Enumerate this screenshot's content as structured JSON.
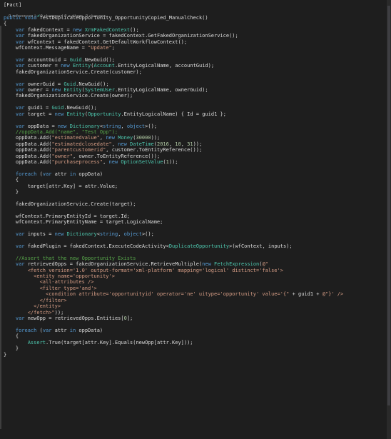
{
  "attribute": "[Fact]",
  "codelens": {
    "references": "0 references",
    "changes": "0 changes",
    "authors": "0 authors, 0 changes"
  },
  "code_lines": [
    [
      [
        "kw",
        "public"
      ],
      [
        "pl",
        " "
      ],
      [
        "kw",
        "void"
      ],
      [
        "pl",
        " TestDuplicateOpportunity_OpportunityCopied_ManualCheck()"
      ]
    ],
    [
      [
        "pl",
        "{"
      ]
    ],
    [
      [
        "pl",
        "    "
      ],
      [
        "kw",
        "var"
      ],
      [
        "pl",
        " fakedContext = "
      ],
      [
        "kw",
        "new"
      ],
      [
        "pl",
        " "
      ],
      [
        "ty",
        "XrmFakedContext"
      ],
      [
        "pl",
        "();"
      ]
    ],
    [
      [
        "pl",
        "    "
      ],
      [
        "kw",
        "var"
      ],
      [
        "pl",
        " fakedOrganizationService = fakedContext.GetFakedOrganizationService();"
      ]
    ],
    [
      [
        "pl",
        "    "
      ],
      [
        "kw",
        "var"
      ],
      [
        "pl",
        " wfContext = fakedContext.GetDefaultWorkflowContext();"
      ]
    ],
    [
      [
        "pl",
        "    wfContext.MessageName = "
      ],
      [
        "st",
        "\"Update\""
      ],
      [
        "pl",
        ";"
      ]
    ],
    [],
    [
      [
        "pl",
        "    "
      ],
      [
        "kw",
        "var"
      ],
      [
        "pl",
        " accountGuid = "
      ],
      [
        "ty",
        "Guid"
      ],
      [
        "pl",
        ".NewGuid();"
      ]
    ],
    [
      [
        "pl",
        "    "
      ],
      [
        "kw",
        "var"
      ],
      [
        "pl",
        " customer = "
      ],
      [
        "kw",
        "new"
      ],
      [
        "pl",
        " "
      ],
      [
        "ty",
        "Entity"
      ],
      [
        "pl",
        "("
      ],
      [
        "ty",
        "Account"
      ],
      [
        "pl",
        ".EntityLogicalName, accountGuid);"
      ]
    ],
    [
      [
        "pl",
        "    fakedOrganizationService.Create(customer);"
      ]
    ],
    [],
    [
      [
        "pl",
        "    "
      ],
      [
        "kw",
        "var"
      ],
      [
        "pl",
        " ownerGuid = "
      ],
      [
        "ty",
        "Guid"
      ],
      [
        "pl",
        ".NewGuid();"
      ]
    ],
    [
      [
        "pl",
        "    "
      ],
      [
        "kw",
        "var"
      ],
      [
        "pl",
        " owner = "
      ],
      [
        "kw",
        "new"
      ],
      [
        "pl",
        " "
      ],
      [
        "ty",
        "Entity"
      ],
      [
        "pl",
        "("
      ],
      [
        "ty",
        "SystemUser"
      ],
      [
        "pl",
        ".EntityLogicalName, ownerGuid);"
      ]
    ],
    [
      [
        "pl",
        "    fakedOrganizationService.Create(owner);"
      ]
    ],
    [],
    [
      [
        "pl",
        "    "
      ],
      [
        "kw",
        "var"
      ],
      [
        "pl",
        " guid1 = "
      ],
      [
        "ty",
        "Guid"
      ],
      [
        "pl",
        ".NewGuid();"
      ]
    ],
    [
      [
        "pl",
        "    "
      ],
      [
        "kw",
        "var"
      ],
      [
        "pl",
        " target = "
      ],
      [
        "kw",
        "new"
      ],
      [
        "pl",
        " "
      ],
      [
        "ty",
        "Entity"
      ],
      [
        "pl",
        "("
      ],
      [
        "ty",
        "Opportunity"
      ],
      [
        "pl",
        ".EntityLogicalName) { Id = guid1 };"
      ]
    ],
    [],
    [
      [
        "pl",
        "    "
      ],
      [
        "kw",
        "var"
      ],
      [
        "pl",
        " oppData = "
      ],
      [
        "kw",
        "new"
      ],
      [
        "pl",
        " "
      ],
      [
        "ty",
        "Dictionary"
      ],
      [
        "pl",
        "<"
      ],
      [
        "kw",
        "string"
      ],
      [
        "pl",
        ", "
      ],
      [
        "kw",
        "object"
      ],
      [
        "pl",
        ">();"
      ]
    ],
    [
      [
        "pl",
        "    "
      ],
      [
        "cm",
        "//oppData.Add(\"name\", \"Test Opp\");"
      ]
    ],
    [
      [
        "pl",
        "    oppData.Add("
      ],
      [
        "st",
        "\"estimatedvalue\""
      ],
      [
        "pl",
        ", "
      ],
      [
        "kw",
        "new"
      ],
      [
        "pl",
        " "
      ],
      [
        "ty",
        "Money"
      ],
      [
        "pl",
        "("
      ],
      [
        "nm",
        "30000"
      ],
      [
        "pl",
        "));"
      ]
    ],
    [
      [
        "pl",
        "    oppData.Add("
      ],
      [
        "st",
        "\"estimatedclosedate\""
      ],
      [
        "pl",
        ", "
      ],
      [
        "kw",
        "new"
      ],
      [
        "pl",
        " "
      ],
      [
        "ty",
        "DateTime"
      ],
      [
        "pl",
        "("
      ],
      [
        "nm",
        "2016"
      ],
      [
        "pl",
        ", "
      ],
      [
        "nm",
        "10"
      ],
      [
        "pl",
        ", "
      ],
      [
        "nm",
        "31"
      ],
      [
        "pl",
        "));"
      ]
    ],
    [
      [
        "pl",
        "    oppData.Add("
      ],
      [
        "st",
        "\"parentcustomerid\""
      ],
      [
        "pl",
        ", customer.ToEntityReference());"
      ]
    ],
    [
      [
        "pl",
        "    oppData.Add("
      ],
      [
        "st",
        "\"owner\""
      ],
      [
        "pl",
        ", owner.ToEntityReference());"
      ]
    ],
    [
      [
        "pl",
        "    oppData.Add("
      ],
      [
        "st",
        "\"purchaseprocess\""
      ],
      [
        "pl",
        ", "
      ],
      [
        "kw",
        "new"
      ],
      [
        "pl",
        " "
      ],
      [
        "ty",
        "OptionSetValue"
      ],
      [
        "pl",
        "("
      ],
      [
        "nm",
        "1"
      ],
      [
        "pl",
        "));"
      ]
    ],
    [],
    [
      [
        "pl",
        "    "
      ],
      [
        "kw",
        "foreach"
      ],
      [
        "pl",
        " ("
      ],
      [
        "kw",
        "var"
      ],
      [
        "pl",
        " attr "
      ],
      [
        "kw",
        "in"
      ],
      [
        "pl",
        " oppData)"
      ]
    ],
    [
      [
        "pl",
        "    {"
      ]
    ],
    [
      [
        "pl",
        "        target[attr.Key] = attr.Value;"
      ]
    ],
    [
      [
        "pl",
        "    }"
      ]
    ],
    [],
    [
      [
        "pl",
        "    fakedOrganizationService.Create(target);"
      ]
    ],
    [],
    [
      [
        "pl",
        "    wfContext.PrimaryEntityId = target.Id;"
      ]
    ],
    [
      [
        "pl",
        "    wfContext.PrimaryEntityName = target.LogicalName;"
      ]
    ],
    [],
    [
      [
        "pl",
        "    "
      ],
      [
        "kw",
        "var"
      ],
      [
        "pl",
        " inputs = "
      ],
      [
        "kw",
        "new"
      ],
      [
        "pl",
        " "
      ],
      [
        "ty",
        "Dictionary"
      ],
      [
        "pl",
        "<"
      ],
      [
        "kw",
        "string"
      ],
      [
        "pl",
        ", "
      ],
      [
        "kw",
        "object"
      ],
      [
        "pl",
        ">();"
      ]
    ],
    [],
    [
      [
        "pl",
        "    "
      ],
      [
        "kw",
        "var"
      ],
      [
        "pl",
        " fakedPlugin = fakedContext.ExecuteCodeActivity<"
      ],
      [
        "ty",
        "DuplicateOpportunity"
      ],
      [
        "pl",
        ">(wfContext, inputs);"
      ]
    ],
    [],
    [
      [
        "pl",
        "    "
      ],
      [
        "cm",
        "//Assert that the new Opportunity Exists"
      ]
    ],
    [
      [
        "pl",
        "    "
      ],
      [
        "kw",
        "var"
      ],
      [
        "pl",
        " retrievedOpps = fakedOrganizationService.RetrieveMultiple("
      ],
      [
        "kw",
        "new"
      ],
      [
        "pl",
        " "
      ],
      [
        "ty",
        "FetchExpression"
      ],
      [
        "pl",
        "("
      ],
      [
        "st",
        "@\""
      ]
    ],
    [
      [
        "st",
        "        <fetch version='1.0' output-format='xml-platform' mapping='logical' distinct='false'>"
      ]
    ],
    [
      [
        "st",
        "          <entity name='opportunity'>"
      ]
    ],
    [
      [
        "st",
        "            <all-attributes />"
      ]
    ],
    [
      [
        "st",
        "            <filter type='and'>"
      ]
    ],
    [
      [
        "st",
        "              <condition attribute='opportunityid' operator='ne' uitype='opportunity' value='{\""
      ],
      [
        "pl",
        " + guid1 + "
      ],
      [
        "st",
        "@\"}' />"
      ]
    ],
    [
      [
        "st",
        "            </filter>"
      ]
    ],
    [
      [
        "st",
        "          </entity>"
      ]
    ],
    [
      [
        "st",
        "        </fetch>\""
      ],
      [
        "pl",
        "));"
      ]
    ],
    [
      [
        "pl",
        "    "
      ],
      [
        "kw",
        "var"
      ],
      [
        "pl",
        " newOpp = retrievedOpps.Entities["
      ],
      [
        "nm",
        "0"
      ],
      [
        "pl",
        "];"
      ]
    ],
    [],
    [
      [
        "pl",
        "    "
      ],
      [
        "kw",
        "foreach"
      ],
      [
        "pl",
        " ("
      ],
      [
        "kw",
        "var"
      ],
      [
        "pl",
        " attr "
      ],
      [
        "kw",
        "in"
      ],
      [
        "pl",
        " oppData)"
      ]
    ],
    [
      [
        "pl",
        "    {"
      ]
    ],
    [
      [
        "pl",
        "        "
      ],
      [
        "ty",
        "Assert"
      ],
      [
        "pl",
        ".True(target[attr.Key].Equals(newOpp[attr.Key]));"
      ]
    ],
    [
      [
        "pl",
        "    }"
      ]
    ],
    [
      [
        "pl",
        "}"
      ]
    ]
  ]
}
